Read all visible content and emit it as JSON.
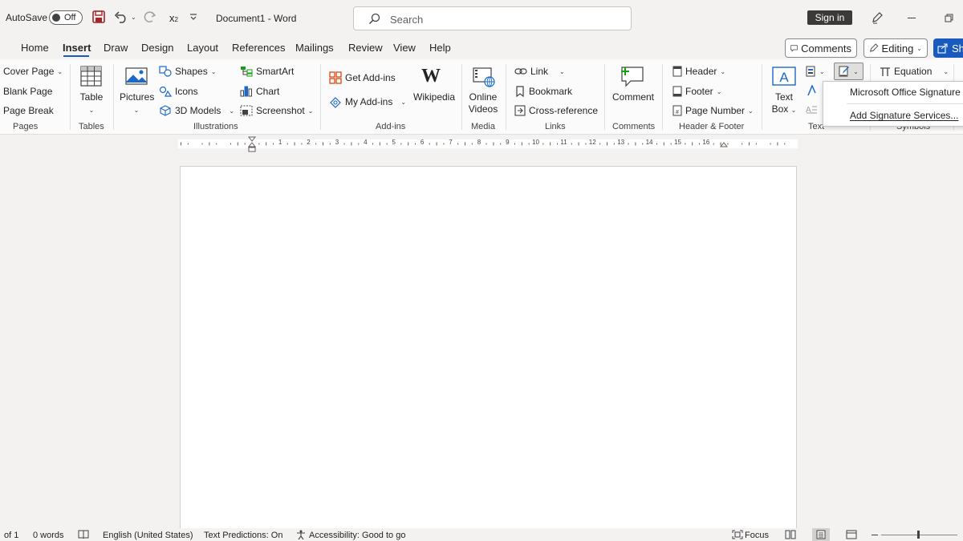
{
  "titlebar": {
    "autosave_label": "AutoSave",
    "autosave_state": "Off",
    "subscript_glyph": "x",
    "subscript_small": "2",
    "doc_title": "Document1  -  Word",
    "search_placeholder": "Search",
    "signin_label": "Sign in"
  },
  "menu": {
    "tabs": [
      "Home",
      "Insert",
      "Draw",
      "Design",
      "Layout",
      "References",
      "Mailings",
      "Review",
      "View",
      "Help"
    ],
    "comments_label": "Comments",
    "editing_label": "Editing",
    "share_label": "Sh"
  },
  "ribbon": {
    "pages": {
      "cover_page": "Cover Page",
      "blank_page": "Blank Page",
      "page_break": "Page Break",
      "group": "Pages"
    },
    "tables": {
      "table": "Table",
      "group": "Tables"
    },
    "illustrations": {
      "pictures": "Pictures",
      "shapes": "Shapes",
      "icons": "Icons",
      "models_3d": "3D Models",
      "smartart": "SmartArt",
      "chart": "Chart",
      "screenshot": "Screenshot",
      "group": "Illustrations"
    },
    "addins": {
      "get_addins": "Get Add-ins",
      "my_addins": "My Add-ins",
      "wikipedia": "Wikipedia",
      "wiki_glyph": "W",
      "group": "Add-ins"
    },
    "media": {
      "online_videos_1": "Online",
      "online_videos_2": "Videos",
      "group": "Media"
    },
    "links": {
      "link": "Link",
      "bookmark": "Bookmark",
      "cross_reference": "Cross-reference",
      "group": "Links"
    },
    "comments": {
      "comment": "Comment",
      "group": "Comments"
    },
    "header_footer": {
      "header": "Header",
      "footer": "Footer",
      "page_number": "Page Number",
      "group": "Header & Footer"
    },
    "text": {
      "text_box_1": "Text",
      "text_box_2": "Box",
      "group": "Text"
    },
    "symbols": {
      "equation": "Equation",
      "group": "Symbols"
    }
  },
  "ruler": {
    "numbers": [
      "1",
      "2",
      "3",
      "4",
      "5",
      "6",
      "7",
      "8",
      "9",
      "10",
      "11",
      "12",
      "13",
      "14",
      "15",
      "16"
    ]
  },
  "signature_menu": {
    "items": [
      "Microsoft Office Signature Line...",
      "Add Signature Services..."
    ]
  },
  "statusbar": {
    "page": "of 1",
    "words": "0 words",
    "language": "English (United States)",
    "predictions": "Text Predictions: On",
    "accessibility": "Accessibility: Good to go",
    "focus": "Focus"
  }
}
